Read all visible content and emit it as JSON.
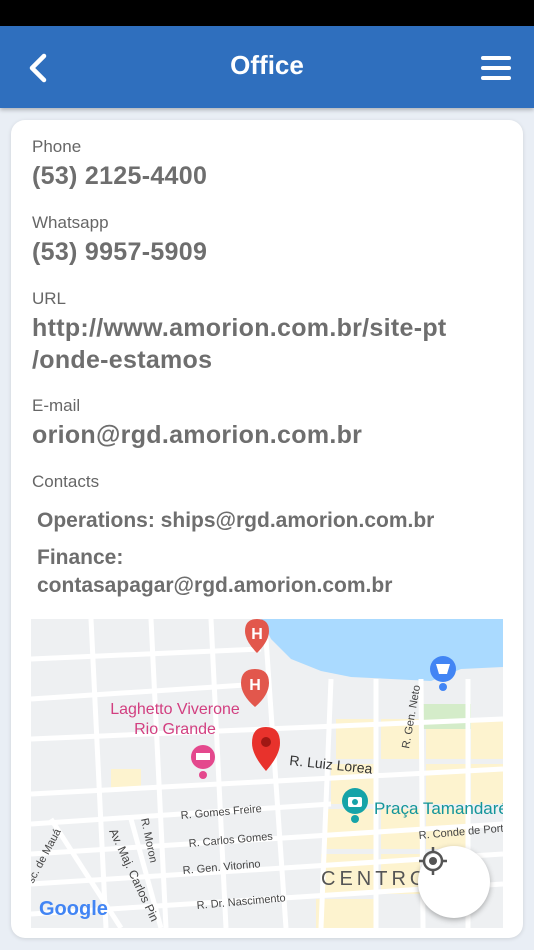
{
  "header": {
    "title": "Office"
  },
  "fields": {
    "phone_label": "Phone",
    "phone_value": "(53) 2125-4400",
    "whatsapp_label": "Whatsapp",
    "whatsapp_value": "(53) 9957-5909",
    "url_label": "URL",
    "url_value_line1": "http://www.amorion.com.br/site-pt",
    "url_value_line2": "/onde-estamos",
    "email_label": "E-mail",
    "email_value": "orion@rgd.amorion.com.br",
    "contacts_label": "Contacts",
    "contacts": [
      {
        "text": "Operations: ships@rgd.amorion.com.br"
      },
      {
        "text_line1": "Finance:",
        "text_line2": "contasapagar@rgd.amorion.com.br"
      }
    ]
  },
  "map": {
    "poi_hotel": "Laghetto Viverone",
    "poi_hotel_line2": "Rio Grande",
    "poi_square": "Praça Tamandaré",
    "area_label": "CENTRO",
    "streets": {
      "luiz_lorea": "R. Luiz Lorea",
      "gomes_freire": "R. Gomes Freire",
      "carlos_gomes": "R. Carlos Gomes",
      "gen_vitorino": "R. Gen. Vitorino",
      "dr_nascimento": "R. Dr. Nascimento",
      "conde_de_porto": "R. Conde de Port",
      "gen_neto": "R. Gen. Neto",
      "moron": "R. Moron",
      "maj_carlos": "Av. Maj. Carlos Pin",
      "maua": "sc. de Mauá"
    },
    "provider_logo": "Google",
    "colors": {
      "water": "#aadaff",
      "road": "#ffffff",
      "land": "#eef0f2",
      "pin": "#e8322c",
      "poi_pink": "#e4488d",
      "poi_teal": "#16a3a8",
      "poi_blue": "#4285f4"
    }
  },
  "colors": {
    "appbar": "#2f6fbe",
    "background": "#e9eef5"
  }
}
